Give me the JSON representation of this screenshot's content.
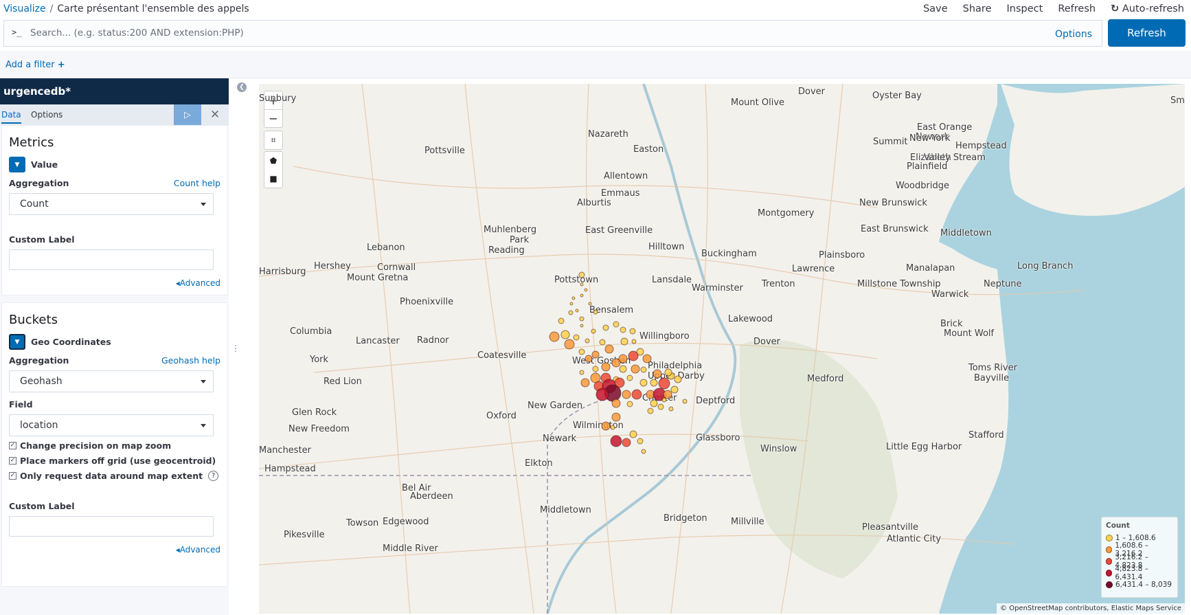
{
  "breadcrumb": {
    "root": "Visualize",
    "separator": "/",
    "title": "Carte présentant l'ensemble des appels"
  },
  "topmenu": {
    "save": "Save",
    "share": "Share",
    "inspect": "Inspect",
    "refresh": "Refresh",
    "auto_refresh": "Auto-refresh"
  },
  "search": {
    "prompt": ">_",
    "placeholder": "Search... (e.g. status:200 AND extension:PHP)",
    "options": "Options",
    "refresh_button": "Refresh"
  },
  "filter": {
    "add_label": "Add a filter",
    "add_icon": "+"
  },
  "sidebar": {
    "index": "urgencedb*",
    "tabs": [
      "Data",
      "Options"
    ],
    "apply_icon": "▷",
    "close_icon": "✕",
    "metrics": {
      "title": "Metrics",
      "agg_name": "Value",
      "aggregation_label": "Aggregation",
      "help": "Count help",
      "aggregation_value": "Count",
      "custom_label": "Custom Label",
      "custom_value": "",
      "advanced": "Advanced"
    },
    "buckets": {
      "title": "Buckets",
      "agg_name": "Geo Coordinates",
      "aggregation_label": "Aggregation",
      "help": "Geohash help",
      "aggregation_value": "Geohash",
      "field_label": "Field",
      "field_value": "location",
      "checks": [
        {
          "label": "Change precision on map zoom",
          "checked": true
        },
        {
          "label": "Place markers off grid (use geocentroid)",
          "checked": true
        },
        {
          "label": "Only request data around map extent",
          "checked": true
        }
      ],
      "help_icon": "?",
      "custom_label": "Custom Label",
      "custom_value": "",
      "advanced": "Advanced"
    }
  },
  "map": {
    "controls": [
      "+",
      "−",
      "⌗",
      "⬟",
      "■"
    ],
    "places": [
      "Sunbury",
      "Mount Olive",
      "Dover",
      "Oyster Bay",
      "Sm",
      "Nazareth",
      "Easton",
      "East Orange",
      "Newark",
      "New York",
      "Summit",
      "Elizabeth",
      "Plainfield",
      "Hempstead",
      "Valley Stream",
      "Pottsville",
      "Allentown",
      "Emmaus",
      "Alburtis",
      "Woodbridge",
      "Montgomery",
      "New Brunswick",
      "East Brunswick",
      "Middletown",
      "Muhlenberg",
      "Park",
      "Reading",
      "East Greenville",
      "Lebanon",
      "Hershey",
      "Cornwall",
      "Mount Gretna",
      "Hilltown",
      "Buckingham",
      "Plainsboro",
      "Lawrence",
      "Manalapan",
      "Long Branch",
      "Harrisburg",
      "Pottstown",
      "Lansdale",
      "Warminster",
      "Trenton",
      "Millstone Township",
      "Neptune",
      "Warwick",
      "Phoenixville",
      "Bensalem",
      "Lakewood",
      "Brick",
      "Mount Wolf",
      "Columbia",
      "Lancaster",
      "Radnor",
      "Willingboro",
      "Dover",
      "Coatesville",
      "West Goshen",
      "Philadelphia",
      "Toms River",
      "York",
      "Upper Darby",
      "Medford",
      "Bayville",
      "Red Lion",
      "Chester",
      "Deptford",
      "New Garden",
      "Oxford",
      "Glen Rock",
      "Wilmington",
      "New Freedom",
      "Newark",
      "Glassboro",
      "Stafford",
      "Manchester",
      "Winslow",
      "Little Egg Harbor",
      "Hampstead",
      "Elkton",
      "Bel Air",
      "Aberdeen",
      "Middletown",
      "Bridgeton",
      "Millville",
      "Pleasantville",
      "Atlantic City",
      "Towson",
      "Edgewood",
      "Pikesville",
      "Middle River"
    ],
    "legend_title": "Count",
    "legend": [
      {
        "label": "1 – 1,608.6",
        "color": "#ffd24d"
      },
      {
        "label": "1,608.6 – 3,216.2",
        "color": "#fa9a3b"
      },
      {
        "label": "3,216.2 – 4,823.8",
        "color": "#ec4a35"
      },
      {
        "label": "4,823.8 – 6,431.4",
        "color": "#c5152f"
      },
      {
        "label": "6,431.4 – 8,039",
        "color": "#7d0a2a"
      }
    ],
    "attribution": "© OpenStreetMap contributors, Elastic Maps Service"
  }
}
